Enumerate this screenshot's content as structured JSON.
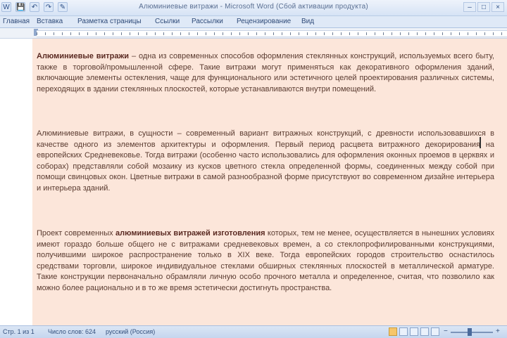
{
  "window": {
    "title": "Алюминиевые витражи - Microsoft Word (Сбой активации продукта)",
    "controls": [
      "–",
      "□",
      "×"
    ]
  },
  "quick_access": [
    "W",
    "💾",
    "↶",
    "↷",
    "✎"
  ],
  "ribbon": {
    "tabs": [
      "Главная",
      "Вставка",
      "Разметка страницы",
      "Ссылки",
      "Рассылки",
      "Рецензирование",
      "Вид"
    ]
  },
  "document": {
    "p1_bold": "Алюминиевые витражи",
    "p1_text": " – одна из современных способов оформления стеклянных конструкций, используемых всего быту, также в торговой/промышленной сфере. Такие витражи могут применяться как декоративного оформления зданий, включающие элементы остекления, чаще для функционального или эстетичного целей проектирования различных системы, переходящих в здании стеклянных плоскостей, которые устанавливаются внутри помещений.",
    "p2_text": "Алюминиевые витражи, в сущности – современный вариант витражных конструкций, с древности использовавшихся в качестве одного из элементов архитектуры и оформления. Первый период расцвета витражного декорирования на европейских Средневековье. Тогда витражи (особенно часто использовались для оформления оконных проемов в церквях и соборах) представляли собой мозаику из кусков цветного стекла определенной формы, соединенных между собой при помощи свинцовых окон. Цветные витражи в самой разнообразной форме присутствуют во современном дизайне интерьера и интерьера зданий.",
    "p3_text_a": "Проект современных ",
    "p3_bold": "алюминиевых витражей изготовления",
    "p3_text_b": " которых, тем не менее, осуществляется в нынешних условиях имеют гораздо больше общего не с витражами средневековых времен, а со стеклопрофилированными конструкциями, получившими широкое распространение только в XIX веке. Тогда европейских городов строительство оснастилось средствами торговли, широкое индивидуальное стеклами обширных стеклянных плоскостей в металлической арматуре. Такие конструкции первоначально обрамляли личную особо прочного металла и определенное, считая, что позволило как можно более рационально и в то же время эстетически достигнуть пространства."
  },
  "statusbar": {
    "page": "Стр. 1 из 1",
    "words": "Число слов: 624",
    "language": "русский (Россия)",
    "zoom_minus": "−",
    "zoom_plus": "+"
  },
  "colors": {
    "page_bg": "#fce6da",
    "ribbon_bg": "#dfe9f7",
    "status_bg": "#c5d6ee"
  }
}
